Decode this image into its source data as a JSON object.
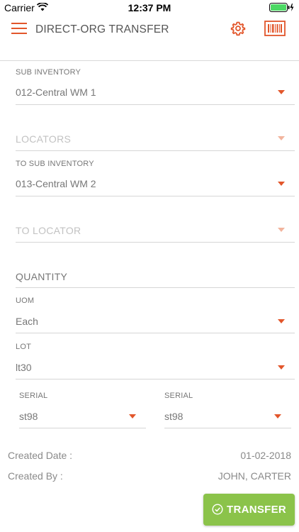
{
  "status_bar": {
    "carrier": "Carrier",
    "time": "12:37 PM"
  },
  "header": {
    "title": "DIRECT-ORG TRANSFER",
    "menu_icon": "hamburger-menu-icon",
    "settings_icon": "gear-icon",
    "scan_icon": "barcode-icon"
  },
  "colors": {
    "accent": "#e2562b",
    "button": "#8bc34a",
    "divider": "#d6d6d6"
  },
  "form": {
    "sub_inventory": {
      "label": "SUB INVENTORY",
      "value": "012-Central WM 1"
    },
    "locators": {
      "placeholder": "LOCATORS"
    },
    "to_sub_inventory": {
      "label": "TO SUB INVENTORY",
      "value": "013-Central WM 2"
    },
    "to_locator": {
      "placeholder": "TO LOCATOR"
    },
    "quantity": {
      "placeholder": "QUANTITY"
    },
    "uom": {
      "label": "UOM",
      "value": "Each"
    },
    "lot": {
      "label": "LOT",
      "value": "lt30"
    },
    "serial_from": {
      "label": "SERIAL",
      "value": "st98"
    },
    "serial_to": {
      "label": "SERIAL",
      "value": "st98"
    }
  },
  "info": {
    "created_date_label": "Created Date :",
    "created_date": "01-02-2018",
    "created_by_label": "Created By :",
    "created_by": "JOHN, CARTER"
  },
  "actions": {
    "transfer_label": "TRANSFER"
  }
}
